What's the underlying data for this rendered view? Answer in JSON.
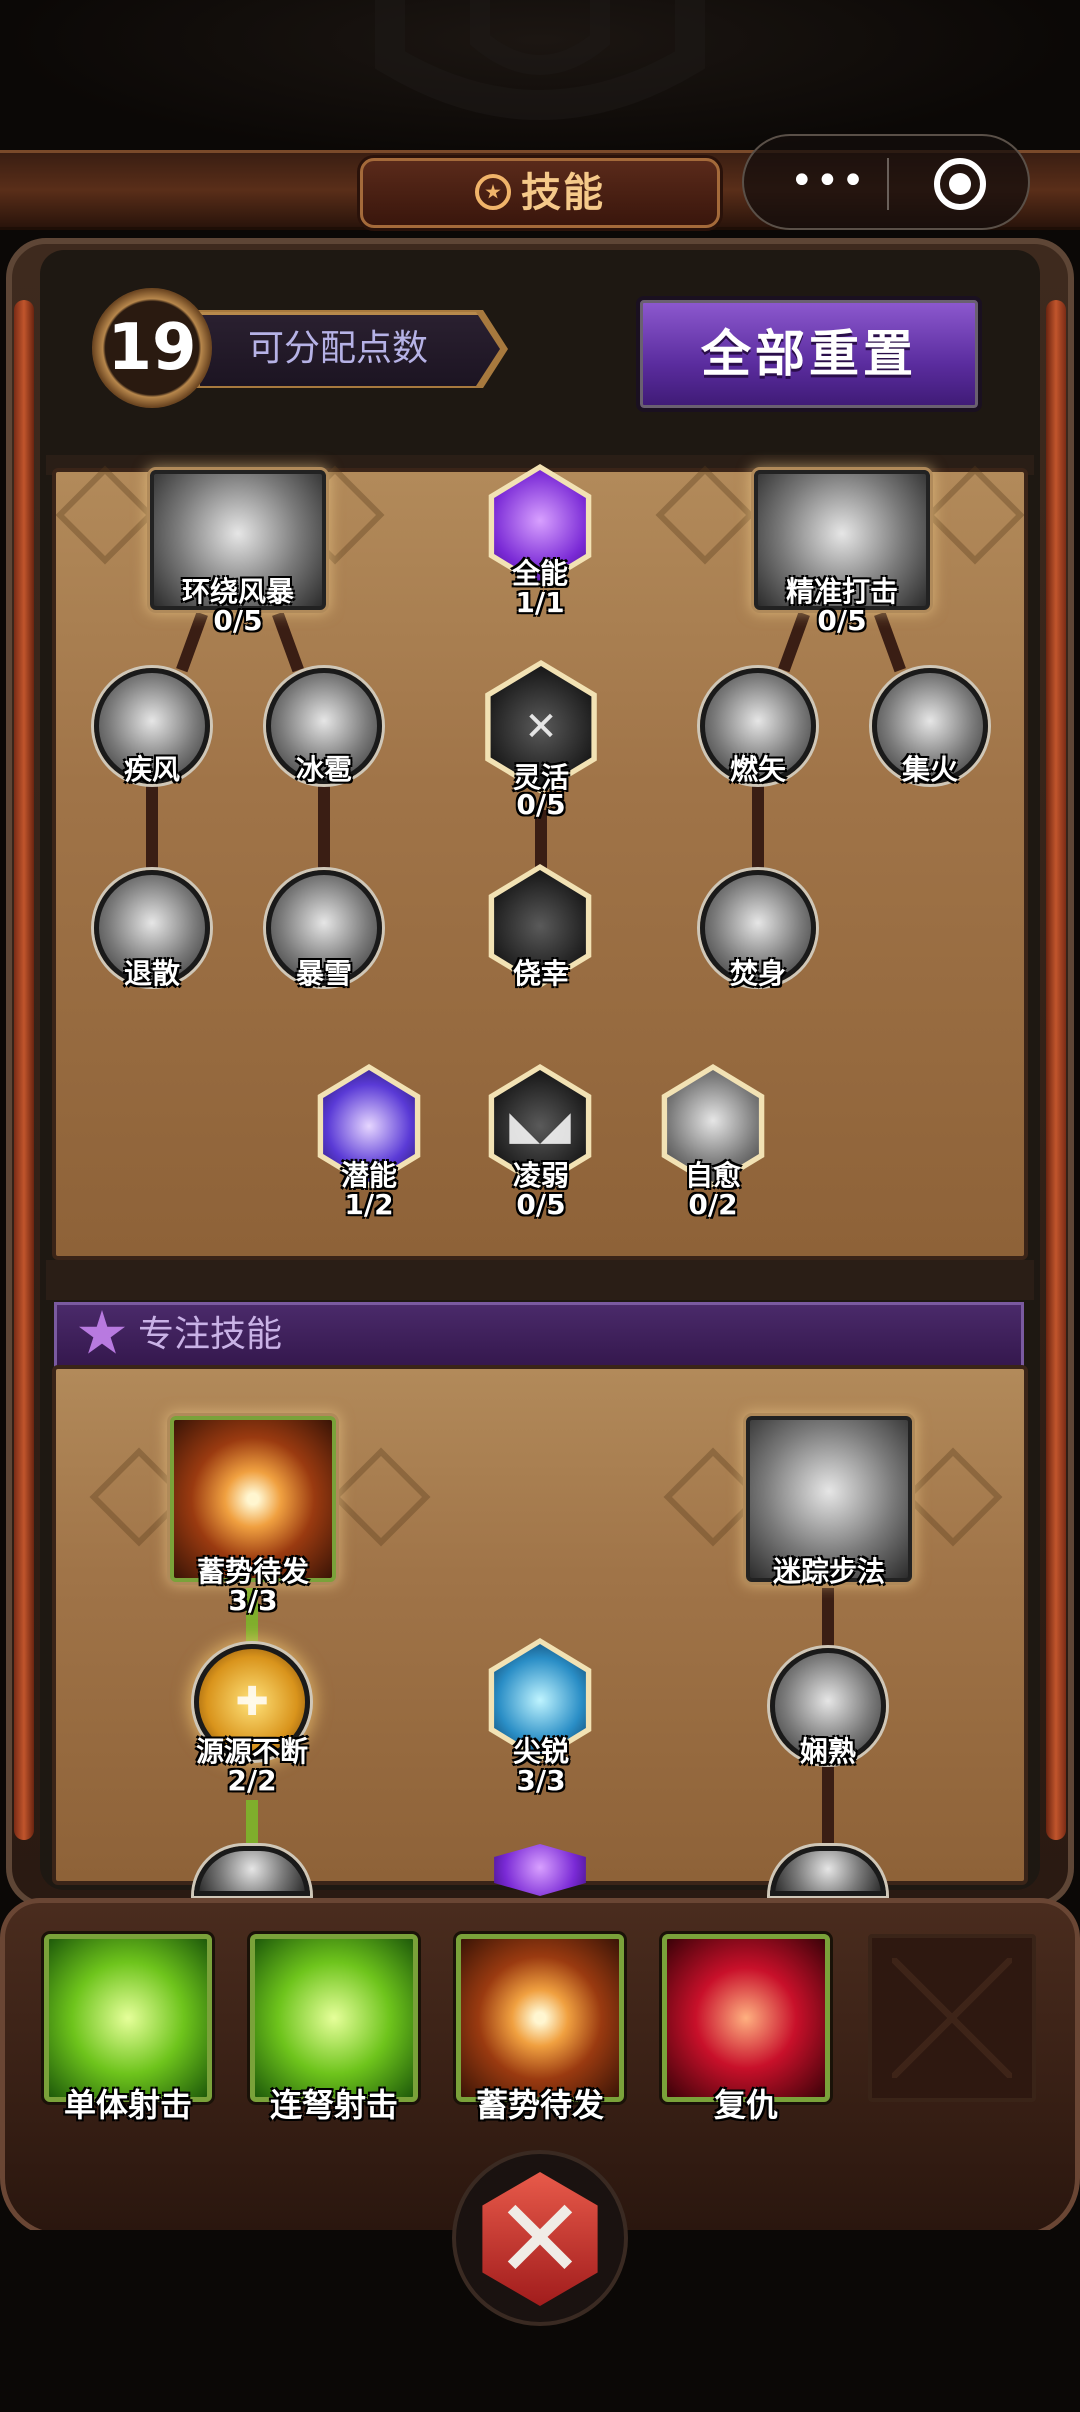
{
  "header": {
    "title": "技能"
  },
  "capsule": {
    "menu_icon": "more-dots-icon",
    "close_icon": "target-icon"
  },
  "points": {
    "value": "19",
    "label": "可分配点数"
  },
  "reset": {
    "label": "全部重置"
  },
  "tree1": {
    "huanrao": {
      "name": "环绕风暴",
      "count": "0/5"
    },
    "quanneng": {
      "name": "全能",
      "count": "1/1"
    },
    "jingzhun": {
      "name": "精准打击",
      "count": "0/5"
    },
    "jifeng": {
      "name": "疾风"
    },
    "bingbao": {
      "name": "冰雹"
    },
    "linghuo": {
      "name": "灵活",
      "count": "0/5"
    },
    "ranshi": {
      "name": "燃矢"
    },
    "jihuo": {
      "name": "集火"
    },
    "tuisan": {
      "name": "退散"
    },
    "baoxue": {
      "name": "暴雪"
    },
    "jiaoxing": {
      "name": "侥幸"
    },
    "fenshen": {
      "name": "焚身"
    },
    "qianneng": {
      "name": "潜能",
      "count": "1/2"
    },
    "lingruo": {
      "name": "凌弱",
      "count": "0/5"
    },
    "ziyu": {
      "name": "自愈",
      "count": "0/2"
    }
  },
  "focus": {
    "title": "专注技能"
  },
  "tree2": {
    "xushi": {
      "name": "蓄势待发",
      "count": "3/3"
    },
    "mizong": {
      "name": "迷踪步法"
    },
    "yuanyuan": {
      "name": "源源不断",
      "count": "2/2"
    },
    "jianrui": {
      "name": "尖锐",
      "count": "3/3"
    },
    "xianshu": {
      "name": "娴熟"
    }
  },
  "tray": {
    "slots": [
      "单体射击",
      "连弩射击",
      "蓄势待发",
      "复仇"
    ]
  }
}
